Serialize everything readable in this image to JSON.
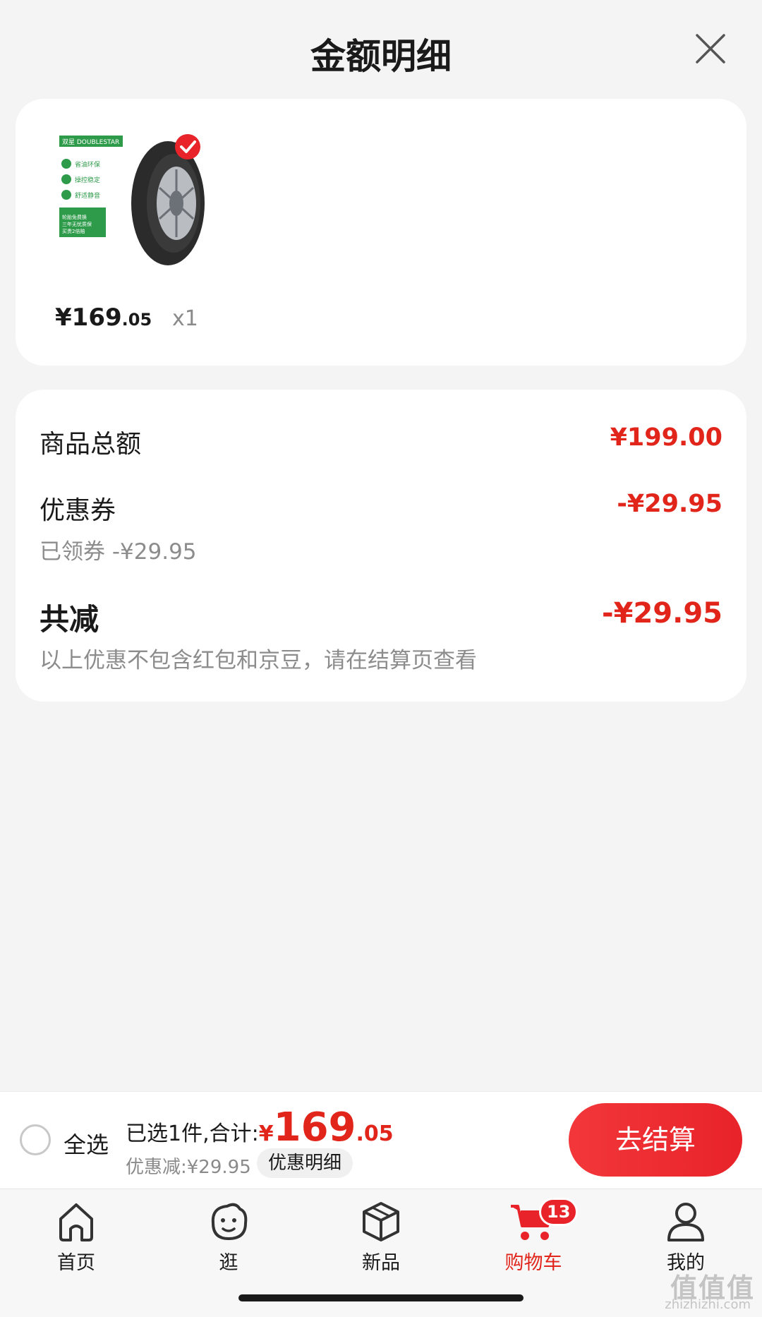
{
  "header": {
    "title": "金额明细"
  },
  "product": {
    "price_int": "¥169",
    "price_dec": ".05",
    "quantity": "x1",
    "image": {
      "brand_text": "双星 DOUBLESTAR",
      "features": [
        "省油环保",
        "操控稳定",
        "舒适静音"
      ],
      "promo": "轮胎免费换 三年无忧质保 买贵2倍赔"
    }
  },
  "breakdown": {
    "total_label": "商品总额",
    "total_value": "¥199.00",
    "coupon_label": "优惠券",
    "coupon_value": "-¥29.95",
    "coupon_sub": "已领券 -¥29.95",
    "reduce_label": "共减",
    "reduce_value": "-¥29.95",
    "reduce_note": "以上优惠不包含红包和京豆，请在结算页查看"
  },
  "bottom_bar": {
    "select_all": "全选",
    "selected_text": "已选1件,合计:",
    "currency": "¥",
    "total_int": "169",
    "total_dec": ".05",
    "discount_text": "优惠减:¥29.95",
    "detail_button": "优惠明细",
    "checkout_button": "去结算"
  },
  "tabs": [
    {
      "label": "首页",
      "icon": "home-icon"
    },
    {
      "label": "逛",
      "icon": "discover-icon"
    },
    {
      "label": "新品",
      "icon": "cube-icon"
    },
    {
      "label": "购物车",
      "icon": "cart-icon",
      "badge": "13",
      "active": true
    },
    {
      "label": "我的",
      "icon": "user-icon"
    }
  ],
  "watermark": {
    "text": "值值值",
    "sub": "zhizhizhi.com"
  },
  "colors": {
    "accent": "#e1251b",
    "background": "#f4f4f4",
    "card": "#ffffff"
  }
}
